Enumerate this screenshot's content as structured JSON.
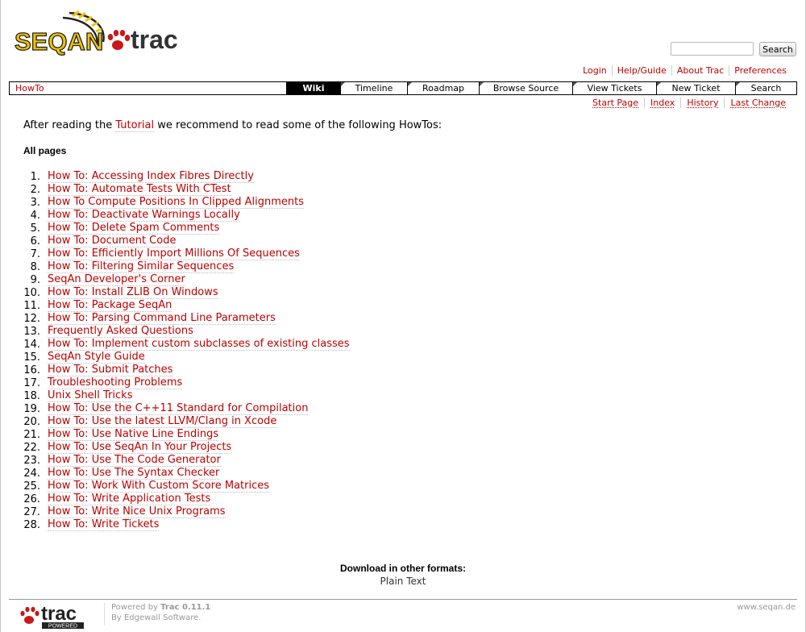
{
  "header": {
    "logo_text_left": "SEQAN",
    "logo_text_right": "trac",
    "search": {
      "placeholder": "",
      "button_label": "Search"
    }
  },
  "metanav": [
    "Login",
    "Help/Guide",
    "About Trac",
    "Preferences"
  ],
  "breadcrumb": "HowTo",
  "mainnav": [
    {
      "label": "Wiki",
      "active": true
    },
    {
      "label": "Timeline",
      "active": false
    },
    {
      "label": "Roadmap",
      "active": false
    },
    {
      "label": "Browse Source",
      "active": false
    },
    {
      "label": "View Tickets",
      "active": false
    },
    {
      "label": "New Ticket",
      "active": false
    },
    {
      "label": "Search",
      "active": false
    }
  ],
  "ctxtnav": [
    "Start Page",
    "Index",
    "History",
    "Last Change"
  ],
  "content": {
    "intro_before": "After reading the ",
    "intro_link": "Tutorial",
    "intro_after": " we recommend to read some of the following HowTos:",
    "heading": "All pages",
    "pages": [
      "How To: Accessing Index Fibres Directly",
      "How To: Automate Tests With CTest",
      "How To Compute Positions In Clipped Alignments",
      "How To: Deactivate Warnings Locally",
      "How To: Delete Spam Comments",
      "How To: Document Code",
      "How To: Efficiently Import Millions Of Sequences",
      "How To: Filtering Similar Sequences",
      "SeqAn Developer's Corner",
      "How To: Install ZLIB On Windows",
      "How To: Package SeqAn",
      "How To: Parsing Command Line Parameters",
      "Frequently Asked Questions",
      "How To: Implement custom subclasses of existing classes",
      "SeqAn Style Guide",
      "How To: Submit Patches",
      "Troubleshooting Problems",
      "Unix Shell Tricks",
      "How To: Use the C++11 Standard for Compilation",
      "How To: Use the latest LLVM/Clang in Xcode",
      "How To: Use Native Line Endings",
      "How To: Use SeqAn In Your Projects",
      "How To: Use The Code Generator",
      "How To: Use The Syntax Checker",
      "How To: Work With Custom Score Matrices",
      "How To: Write Application Tests",
      "How To: Write Nice Unix Programs",
      "How To: Write Tickets"
    ]
  },
  "download": {
    "label": "Download in other formats:",
    "format": "Plain Text"
  },
  "footer": {
    "logo_text": "trac",
    "logo_sub": "POWERED",
    "powered_by": "Powered by ",
    "trac_version": "Trac 0.11.1",
    "by_line": "By Edgewall Software.",
    "site": "www.seqan.de"
  },
  "colors": {
    "link": "#bb0000",
    "active_tab": "#000000",
    "logo_yellow": "#f2c400"
  }
}
